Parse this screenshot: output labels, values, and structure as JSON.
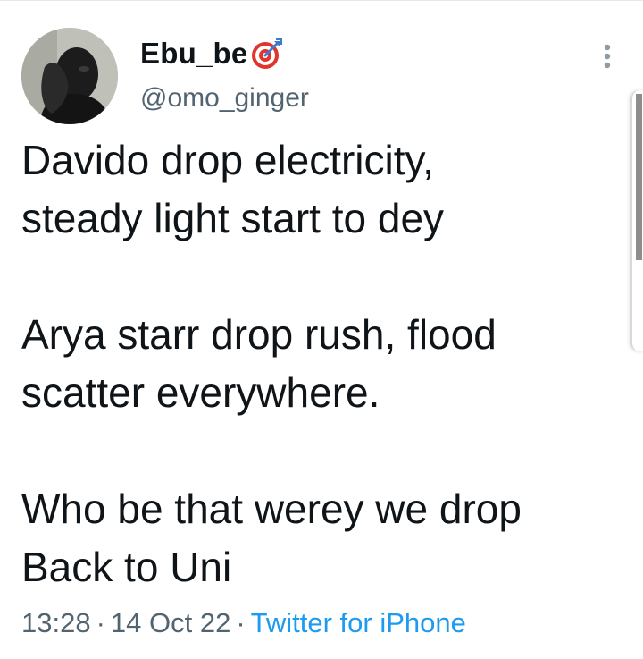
{
  "author": {
    "display_name": "Ebu_be",
    "badge_icon": "direct-hit-emoji-icon",
    "handle": "@omo_ginger",
    "avatar": "avatar-photo"
  },
  "menu": {
    "icon": "more-vertical-icon"
  },
  "tweet": {
    "lines": [
      "Davido drop electricity,",
      "steady light start to dey",
      "",
      "Arya starr drop rush, flood",
      "scatter everywhere.",
      "",
      "Who be that werey we drop",
      "Back to Uni"
    ]
  },
  "meta": {
    "time": "13:28",
    "separator": "·",
    "date": "14 Oct 22",
    "source": "Twitter for iPhone"
  },
  "colors": {
    "text_primary": "#0f1419",
    "text_secondary": "#536471",
    "link": "#1d9bf0",
    "badge_red": "#e0342c"
  }
}
